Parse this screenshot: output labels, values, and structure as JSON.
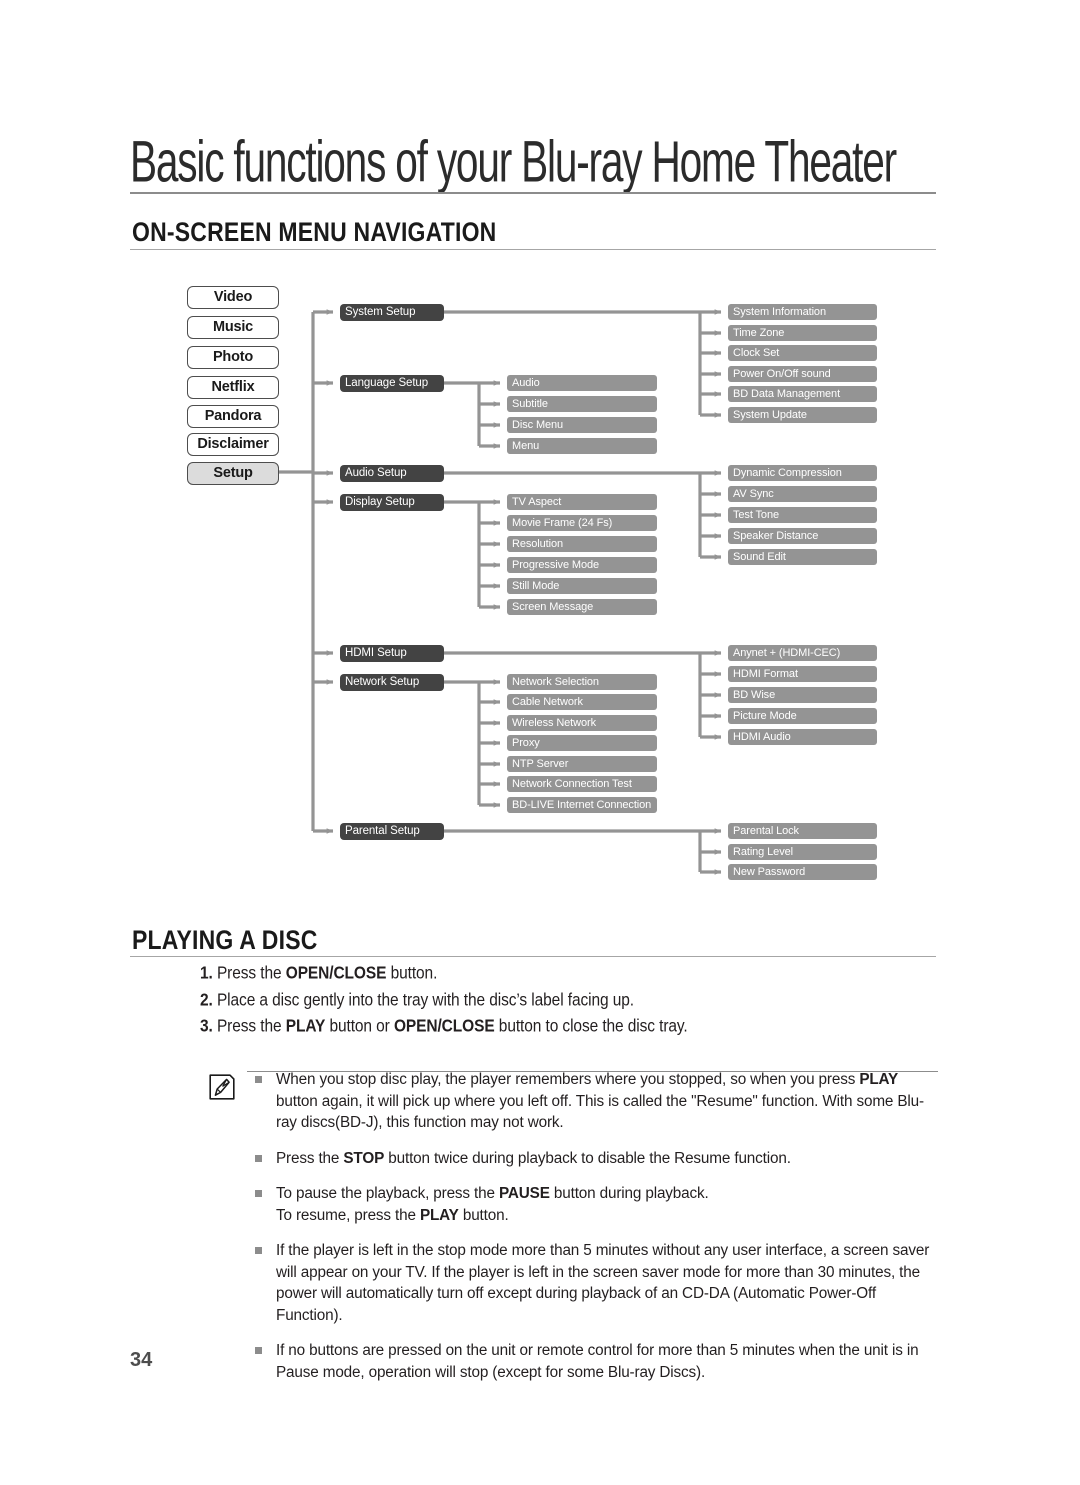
{
  "page": {
    "chapter_title": "Basic functions of your Blu-ray Home Theater",
    "page_number": "34"
  },
  "sections": {
    "onscreen_menu": {
      "heading": "ON-SCREEN MENU NAVIGATION"
    },
    "playing_disc": {
      "heading": "PLAYING A DISC"
    }
  },
  "menu_buttons": [
    {
      "label": "Video",
      "selected": false
    },
    {
      "label": "Music",
      "selected": false
    },
    {
      "label": "Photo",
      "selected": false
    },
    {
      "label": "Netflix",
      "selected": false
    },
    {
      "label": "Pandora",
      "selected": false
    },
    {
      "label": "Disclaimer",
      "selected": false
    },
    {
      "label": "Setup",
      "selected": true
    }
  ],
  "setup_groups": [
    {
      "label": "System Setup",
      "children_column": "right",
      "children": [
        "System Information",
        "Time Zone",
        "Clock Set",
        "Power On/Off sound",
        "BD Data Management",
        "System Update"
      ]
    },
    {
      "label": "Language Setup",
      "children_column": "mid",
      "children": [
        "Audio",
        "Subtitle",
        "Disc Menu",
        "Menu"
      ]
    },
    {
      "label": "Audio Setup",
      "children_column": "right",
      "children": [
        "Dynamic Compression",
        "AV Sync",
        "Test Tone",
        "Speaker Distance",
        "Sound Edit"
      ]
    },
    {
      "label": "Display Setup",
      "children_column": "mid",
      "children": [
        "TV Aspect",
        "Movie Frame (24 Fs)",
        "Resolution",
        "Progressive Mode",
        "Still Mode",
        "Screen Message"
      ]
    },
    {
      "label": "HDMI Setup",
      "children_column": "right",
      "children": [
        "Anynet + (HDMI-CEC)",
        "HDMI Format",
        "BD Wise",
        "Picture Mode",
        "HDMI Audio"
      ]
    },
    {
      "label": "Network Setup",
      "children_column": "mid",
      "children": [
        "Network Selection",
        "Cable Network",
        "Wireless Network",
        "Proxy",
        "NTP Server",
        "Network Connection Test",
        "BD-LIVE Internet Connection"
      ]
    },
    {
      "label": "Parental Setup",
      "children_column": "right",
      "children": [
        "Parental Lock",
        "Rating Level",
        "New Password"
      ]
    }
  ],
  "playing_steps": [
    {
      "number": "1.",
      "html": "Press the <b>OPEN/CLOSE</b> button."
    },
    {
      "number": "2.",
      "html": "Place a disc gently into the tray with the disc&rsquo;s label facing up."
    },
    {
      "number": "3.",
      "html": "Press the <b>PLAY</b> button or <b>OPEN/CLOSE</b> button to close the disc tray."
    }
  ],
  "notes": {
    "icon": "note-pencil-icon",
    "items": [
      "When you stop disc play, the player remembers where you stopped, so when you press <b>PLAY</b> button again, it will pick up where you left off. This is called the \"Resume\" function. With some Blu-ray discs(BD-J), this function may not work.",
      "Press the <b>STOP</b> button twice during playback to disable the Resume function.",
      "To pause the playback, press the <b>PAUSE</b> button during playback.<br>To resume, press the <b>PLAY</b> button.",
      "If the player is left in the stop mode more than 5 minutes without any user interface, a screen saver will appear on your TV. If the player is left in the screen saver mode for more than 30 minutes, the power will automatically turn off except during playback of an CD-DA (Automatic Power-Off Function).",
      "If no buttons are pressed on the unit or remote control for more than 5 minutes when the unit is in Pause mode, operation will stop (except for some Blu-ray Discs)."
    ]
  },
  "colors": {
    "dark_node": "#434343",
    "grey_node": "#949494",
    "connector": "#949494",
    "selected_menu": "#dcdcdc"
  }
}
